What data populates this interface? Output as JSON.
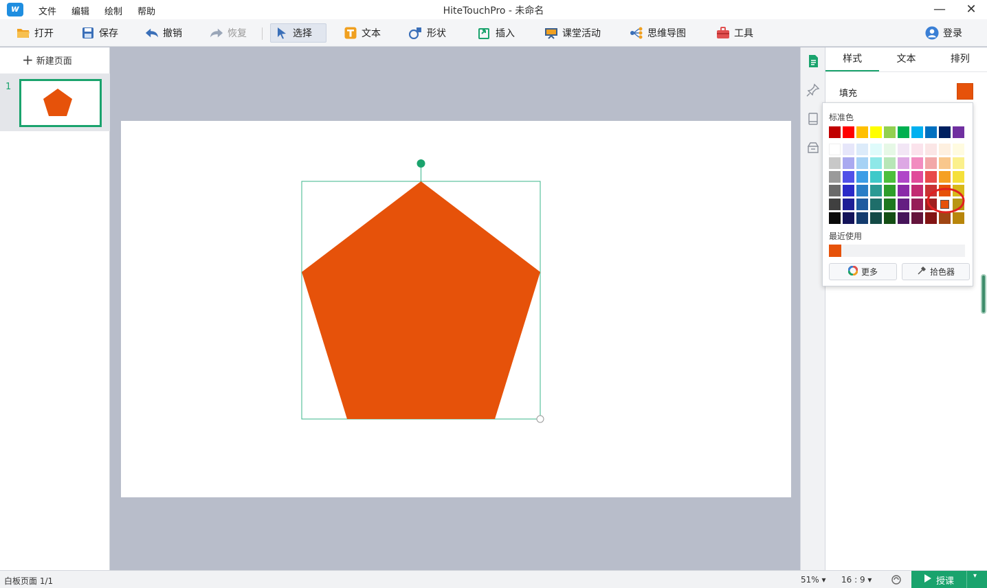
{
  "window": {
    "title": "HiteTouchPro - 未命名",
    "minimize_glyph": "—",
    "close_glyph": "✕"
  },
  "menu": [
    "文件",
    "编辑",
    "绘制",
    "帮助"
  ],
  "toolbar": {
    "open": "打开",
    "save": "保存",
    "undo": "撤销",
    "redo": "恢复",
    "select": "选择",
    "text": "文本",
    "shape": "形状",
    "insert": "插入",
    "classroom": "课堂活动",
    "mindmap": "思维导图",
    "tools": "工具",
    "login": "登录"
  },
  "left_panel": {
    "new_page": "新建页面",
    "pages": [
      {
        "number": "1"
      }
    ]
  },
  "right_panel": {
    "tabs": [
      "样式",
      "文本",
      "排列"
    ],
    "fill_label": "填充",
    "fill_color": "#e6520a"
  },
  "color_popup": {
    "standard_label": "标准色",
    "standard_colors": [
      "#c00000",
      "#ff0000",
      "#ffc000",
      "#ffff00",
      "#92d050",
      "#00b050",
      "#00b0f0",
      "#0070c0",
      "#002060",
      "#7030a0"
    ],
    "palette_rows": [
      [
        "#ffffff",
        "#e6e6fa",
        "#dcebfa",
        "#dffbfb",
        "#e6f8e6",
        "#f2e6f5",
        "#fbe3ec",
        "#fbe6e6",
        "#fef0e0",
        "#fffbe0"
      ],
      [
        "#c8c8c8",
        "#a9a9f0",
        "#a6d2f5",
        "#8ee8e8",
        "#b7e6b7",
        "#dda8e4",
        "#f28cc0",
        "#f2a8a8",
        "#f9c78c",
        "#fbf08c"
      ],
      [
        "#9a9a9a",
        "#5050e8",
        "#3c9de6",
        "#3fc9c9",
        "#4dbf3c",
        "#b046c8",
        "#e04a9a",
        "#e84a4a",
        "#f5a023",
        "#f5e03a"
      ],
      [
        "#6a6a6a",
        "#2a2ac8",
        "#2a7ec6",
        "#2a9a94",
        "#2e9e2a",
        "#8a2aa8",
        "#c22a72",
        "#c83232",
        "#e6520a",
        "#d8b81a"
      ],
      [
        "#404040",
        "#1e1e96",
        "#1e5aa0",
        "#1e6e6a",
        "#1e781e",
        "#641e82",
        "#961e58",
        "#a01e1e",
        "#e6520a",
        "#b89614"
      ],
      [
        "#0a0a0a",
        "#14145a",
        "#143c6e",
        "#144a46",
        "#144e14",
        "#46145a",
        "#64143c",
        "#821414",
        "#a04614",
        "#b8860b"
      ]
    ],
    "selected_color": "#e6520a",
    "recent_label": "最近使用",
    "recent_colors": [
      "#e6520a"
    ],
    "more_button": "更多",
    "picker_button": "拾色器"
  },
  "shape": {
    "type": "pentagon",
    "fill": "#e6520a"
  },
  "status": {
    "page_info": "白板页面 1/1",
    "zoom": "51%",
    "ratio": "16 : 9",
    "teach_button": "授课"
  }
}
